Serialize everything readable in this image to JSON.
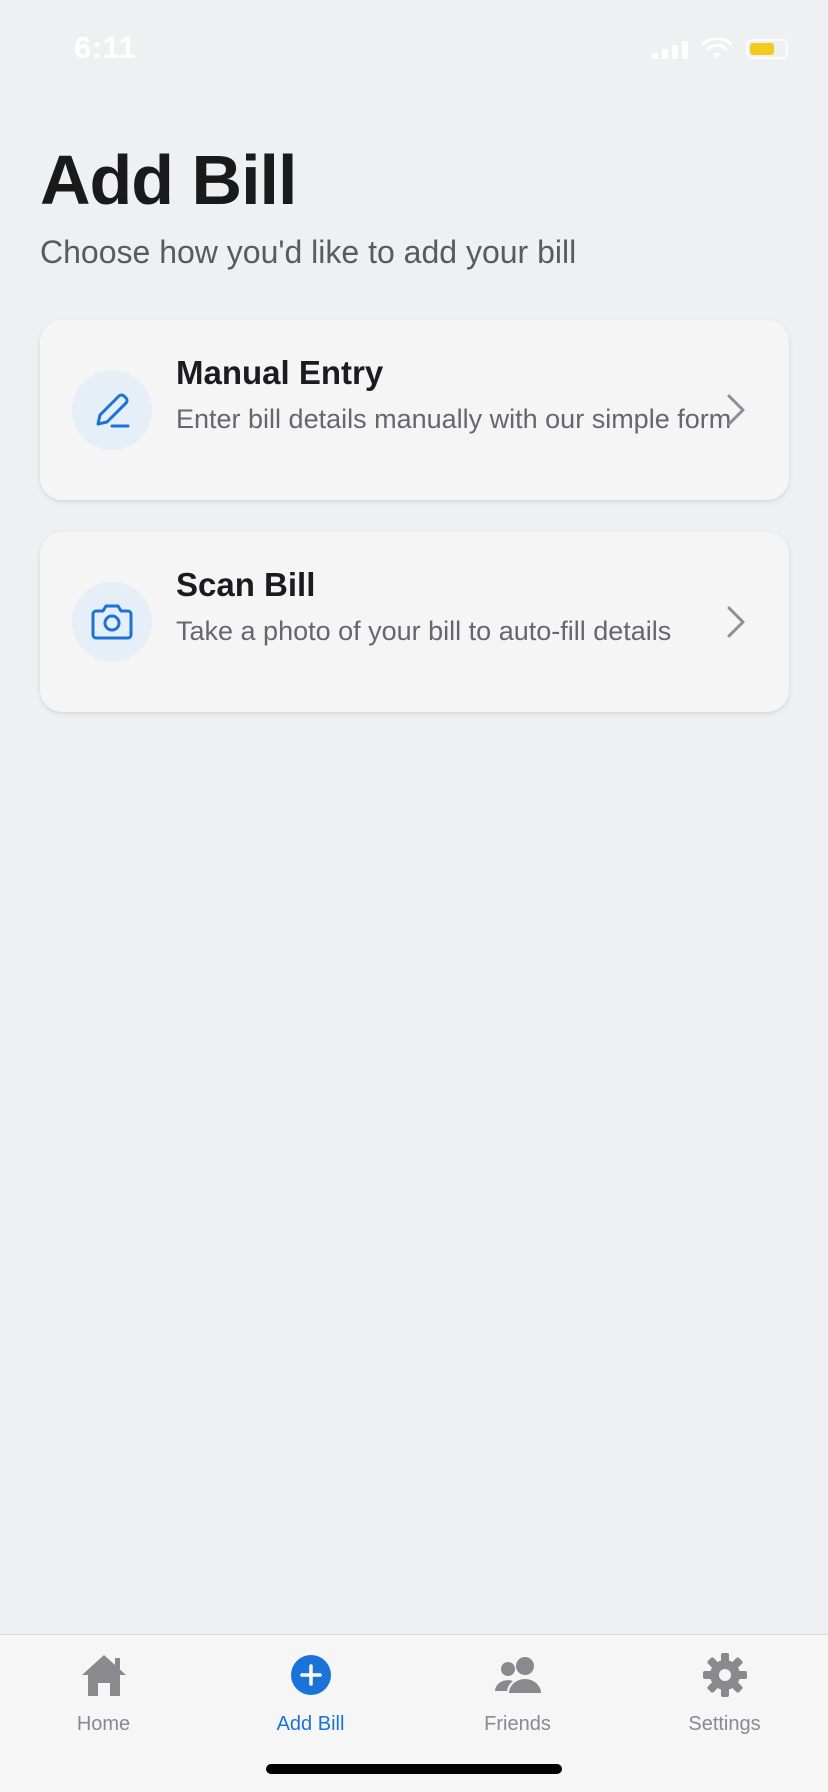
{
  "status_bar": {
    "time": "6:11",
    "battery_color": "#f2cb1d"
  },
  "header": {
    "title": "Add Bill",
    "subtitle": "Choose how you'd like to add your bill"
  },
  "options": [
    {
      "title": "Manual Entry",
      "description": "Enter bill details manually with our simple form",
      "icon": "pencil-icon"
    },
    {
      "title": "Scan Bill",
      "description": "Take a photo of your bill to auto-fill details",
      "icon": "camera-icon"
    }
  ],
  "tab_bar": {
    "items": [
      {
        "label": "Home",
        "icon": "home-icon",
        "active": false
      },
      {
        "label": "Add Bill",
        "icon": "plus-circle-icon",
        "active": true
      },
      {
        "label": "Friends",
        "icon": "people-icon",
        "active": false
      },
      {
        "label": "Settings",
        "icon": "gear-icon",
        "active": false
      }
    ]
  },
  "colors": {
    "accent": "#1a73d9",
    "background": "#eff0f2",
    "card": "#f5f5f6",
    "icon_circle": "#e6eef8"
  }
}
